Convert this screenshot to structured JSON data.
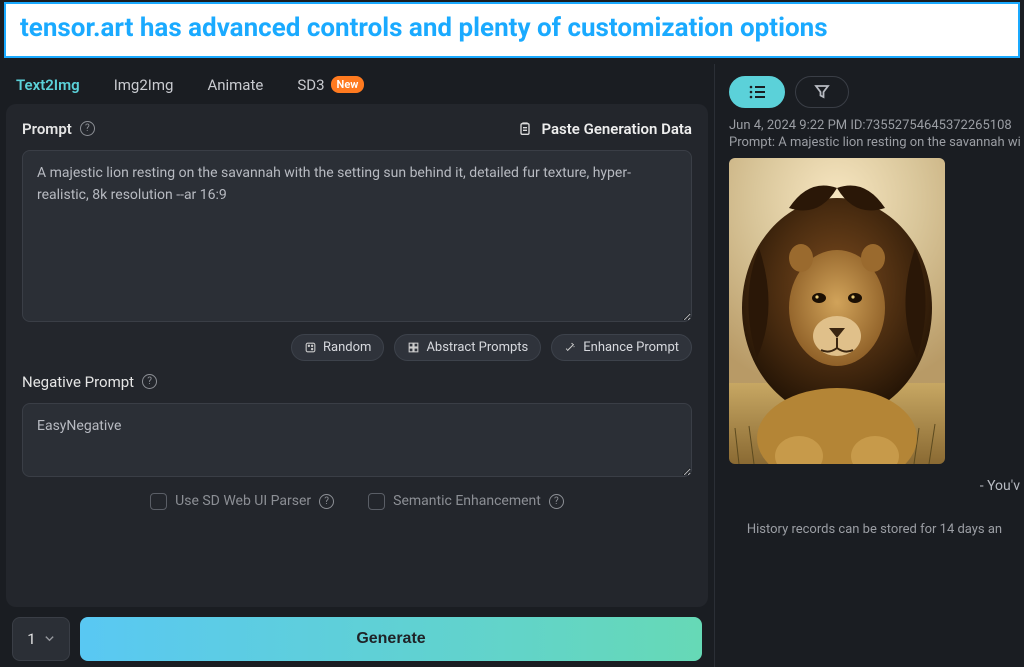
{
  "banner": "tensor.art has advanced controls and plenty of customization options",
  "tabs": {
    "text2img": "Text2Img",
    "img2img": "Img2Img",
    "animate": "Animate",
    "sd3": "SD3",
    "new_badge": "New"
  },
  "prompt": {
    "label": "Prompt",
    "paste": "Paste Generation Data",
    "value": "A majestic lion resting on the savannah with the setting sun behind it, detailed fur texture, hyper-realistic, 8k resolution --ar 16:9",
    "random": "Random",
    "abstract": "Abstract Prompts",
    "enhance": "Enhance Prompt"
  },
  "negative": {
    "label": "Negative Prompt",
    "value": "EasyNegative"
  },
  "checks": {
    "parser": "Use SD Web UI Parser",
    "semantic": "Semantic Enhancement"
  },
  "generate": {
    "qty": "1",
    "button": "Generate"
  },
  "history": {
    "timestamp": "Jun 4, 2024 9:22 PM",
    "id_label": "ID:",
    "id": "73552754645372265108",
    "prompt_label": "Prompt:",
    "prompt_preview": "A majestic lion resting on the savannah wi",
    "youve": "- You'v",
    "note": "History records can be stored for 14 days an"
  }
}
